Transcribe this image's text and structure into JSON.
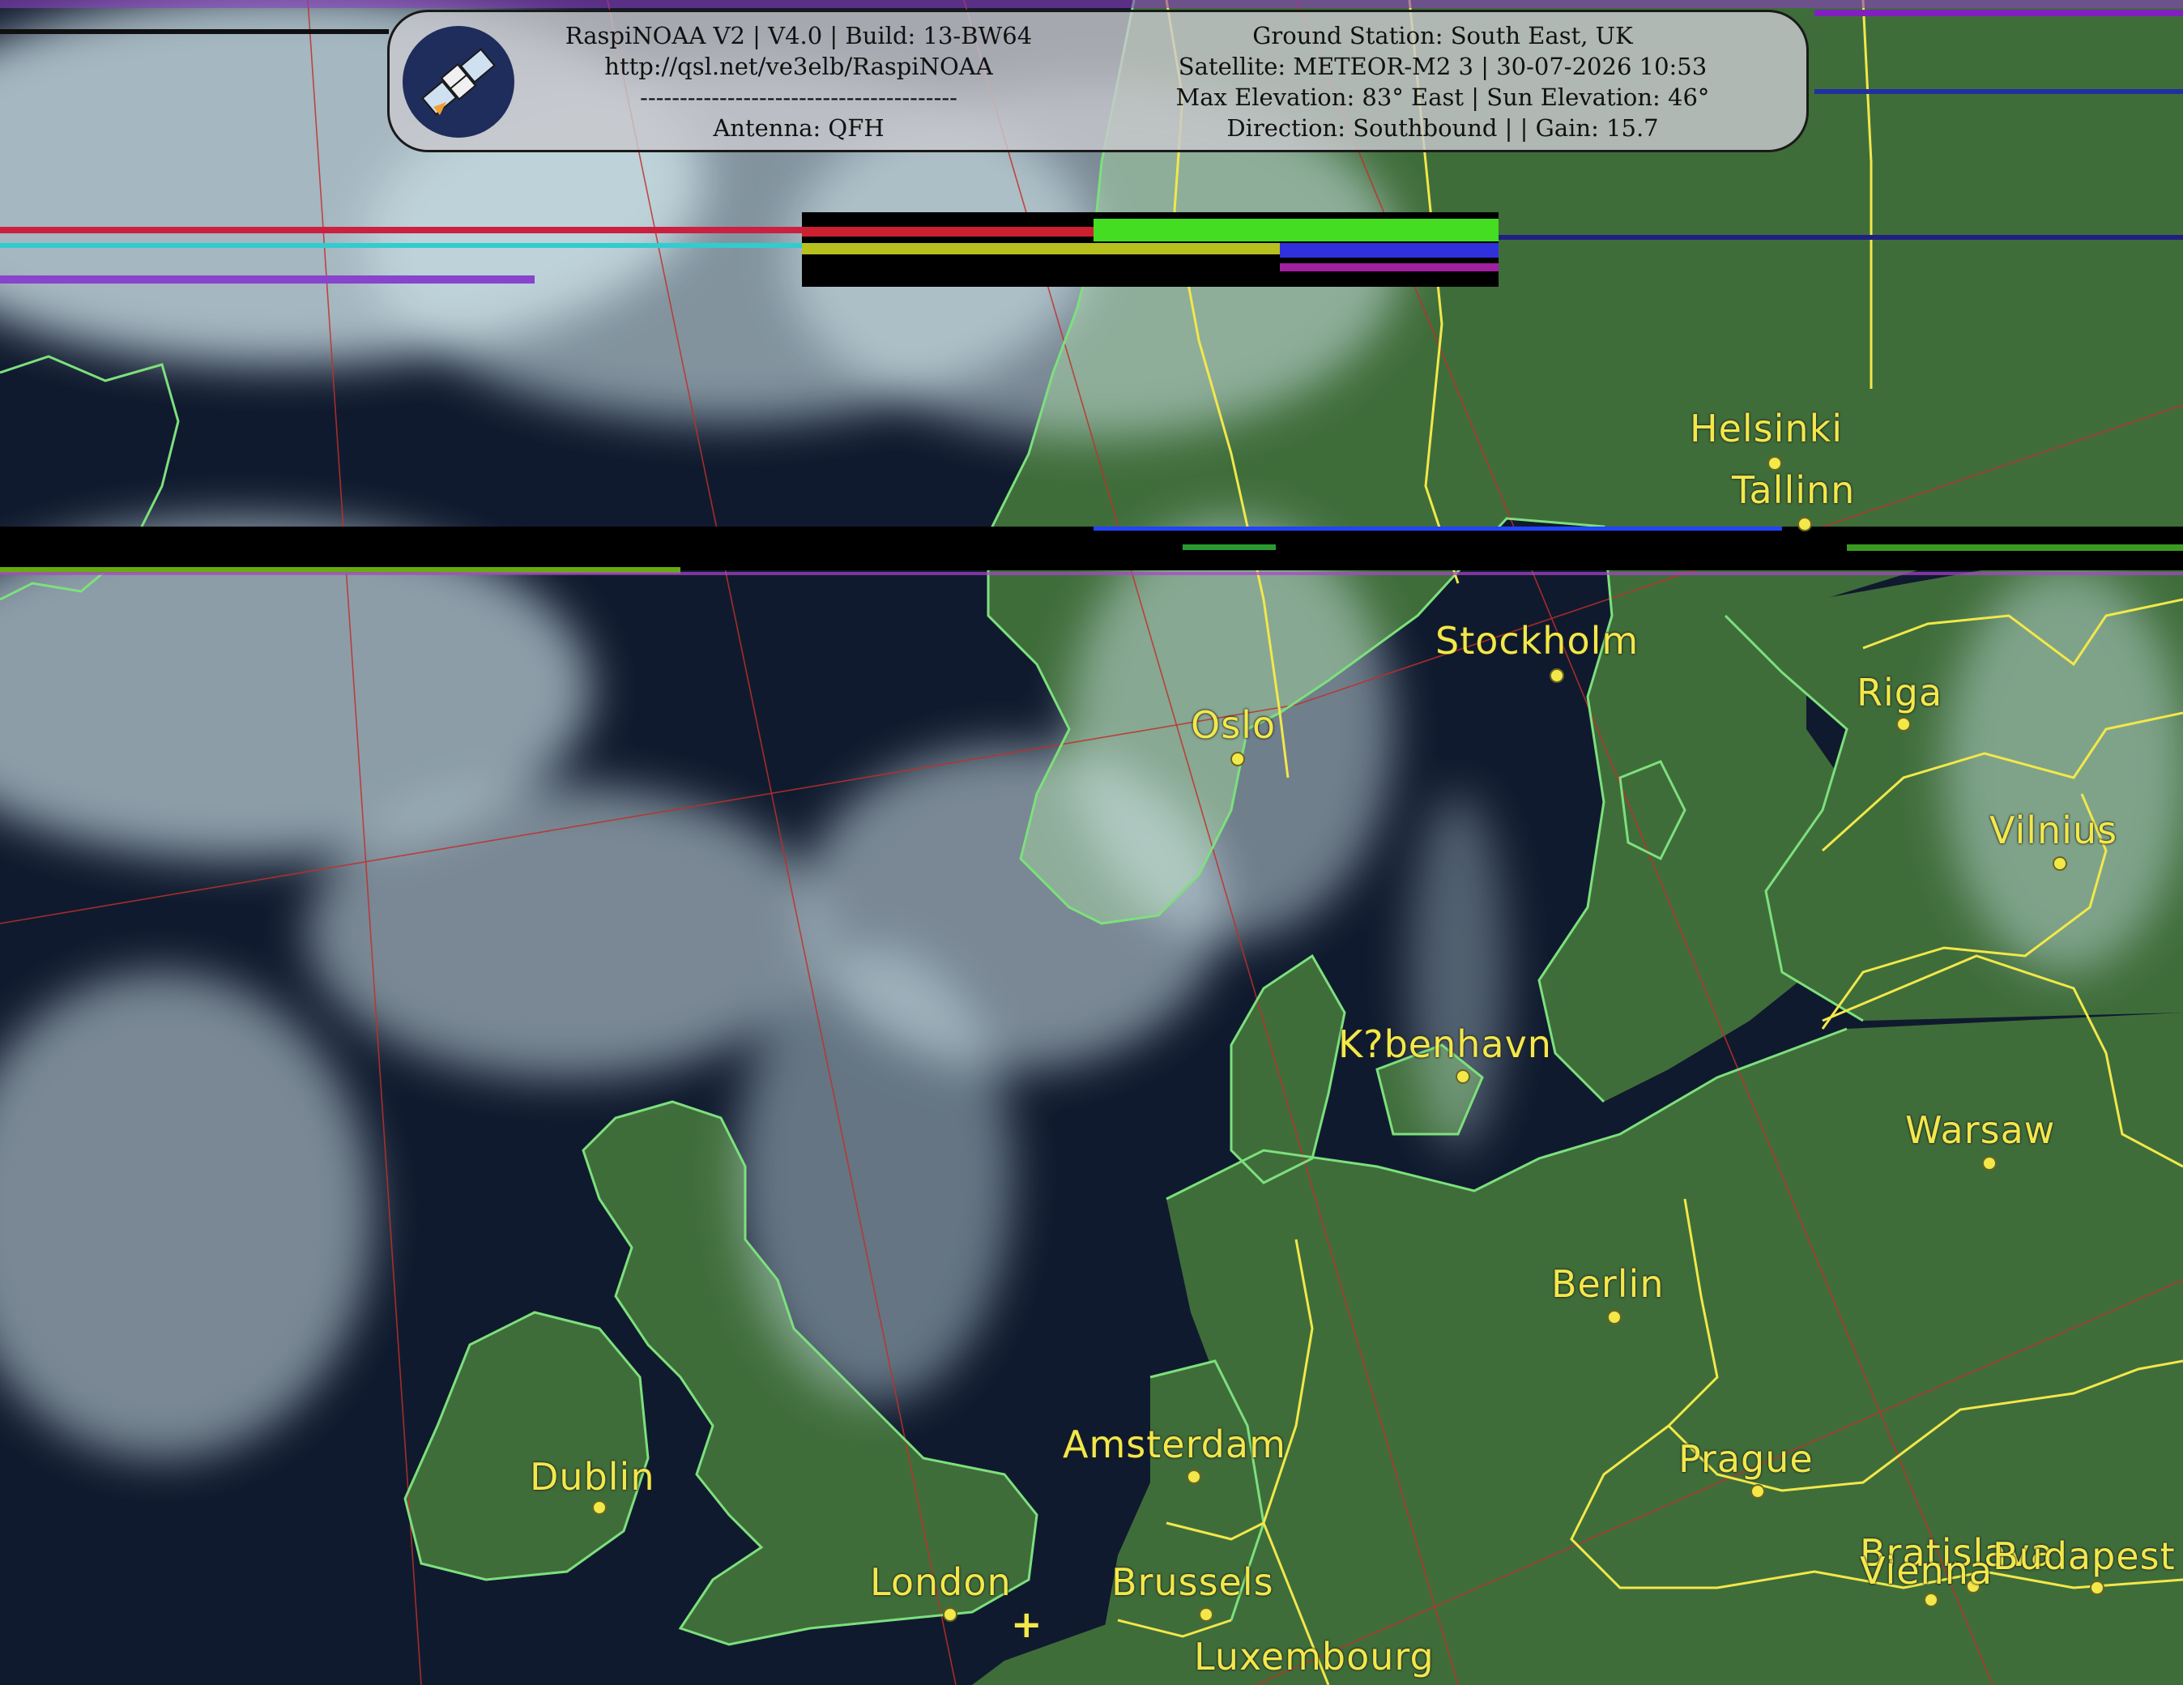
{
  "header": {
    "left_lines": [
      "RaspiNOAA V2 | V4.0 | Build: 13-BW64",
      "http://qsl.net/ve3elb/RaspiNOAA",
      "----------------------------------------",
      "Antenna: QFH"
    ],
    "right_lines": [
      "Ground Station: South East, UK",
      "Satellite: METEOR-M2 3 | 30-07-2026 10:53",
      "Max Elevation: 83° East | Sun Elevation: 46°",
      "Direction: Southbound | | Gain: 15.7"
    ],
    "logo_icon": "satellite-icon"
  },
  "colors": {
    "label": "#f2e84a",
    "coastline": "#7de07d",
    "border": "#f2e84a",
    "graticule": "#c0302a",
    "sea": "#101a2e",
    "land": "#3f6d3a",
    "cloud": "#cfe4ea"
  },
  "cities": [
    {
      "name": "Helsinki"
    },
    {
      "name": "Tallinn"
    },
    {
      "name": "Stockholm"
    },
    {
      "name": "Riga"
    },
    {
      "name": "Oslo"
    },
    {
      "name": "Vilnius"
    },
    {
      "name": "K?benhavn"
    },
    {
      "name": "Warsaw"
    },
    {
      "name": "Berlin"
    },
    {
      "name": "Dublin"
    },
    {
      "name": "Amsterdam"
    },
    {
      "name": "Prague"
    },
    {
      "name": "London"
    },
    {
      "name": "Brussels"
    },
    {
      "name": "Bratislava"
    },
    {
      "name": "Vienna"
    },
    {
      "name": "Budapest"
    },
    {
      "name": "Luxembourg"
    }
  ],
  "station_marker": {
    "icon": "ground-station-cross-icon",
    "glyph": "+"
  }
}
